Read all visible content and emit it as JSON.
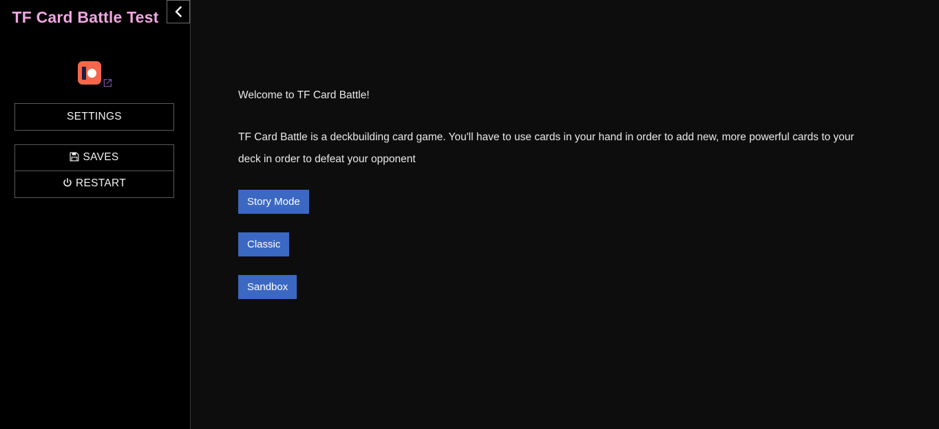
{
  "sidebar": {
    "title": "TF Card Battle Test",
    "collapse_button": {
      "label": "",
      "icon": "chevron-left-icon"
    },
    "patreon": {
      "label": "Patreon",
      "icon": "patreon-icon",
      "external_icon": "external-link-icon"
    },
    "menu": {
      "settings": {
        "label": "SETTINGS"
      },
      "saves": {
        "label": "SAVES",
        "icon": "save-icon"
      },
      "restart": {
        "label": "RESTART",
        "icon": "power-icon"
      }
    }
  },
  "main": {
    "welcome_heading": "Welcome to TF Card Battle!",
    "intro_paragraph": "TF Card Battle is a deckbuilding card game. You'll have to use cards in your hand in order to add new, more powerful cards to your deck in order to defeat your opponent",
    "mode_buttons": [
      {
        "label": "Story Mode"
      },
      {
        "label": "Classic"
      },
      {
        "label": "Sandbox"
      }
    ]
  },
  "colors": {
    "title_pink": "#f0a6e0",
    "button_blue": "#3b68c2",
    "patreon_coral": "#f4674a",
    "sidebar_bg": "#000000",
    "main_bg": "#0d0d0d",
    "text": "#e9e9e9",
    "border": "#5a5a5a"
  }
}
